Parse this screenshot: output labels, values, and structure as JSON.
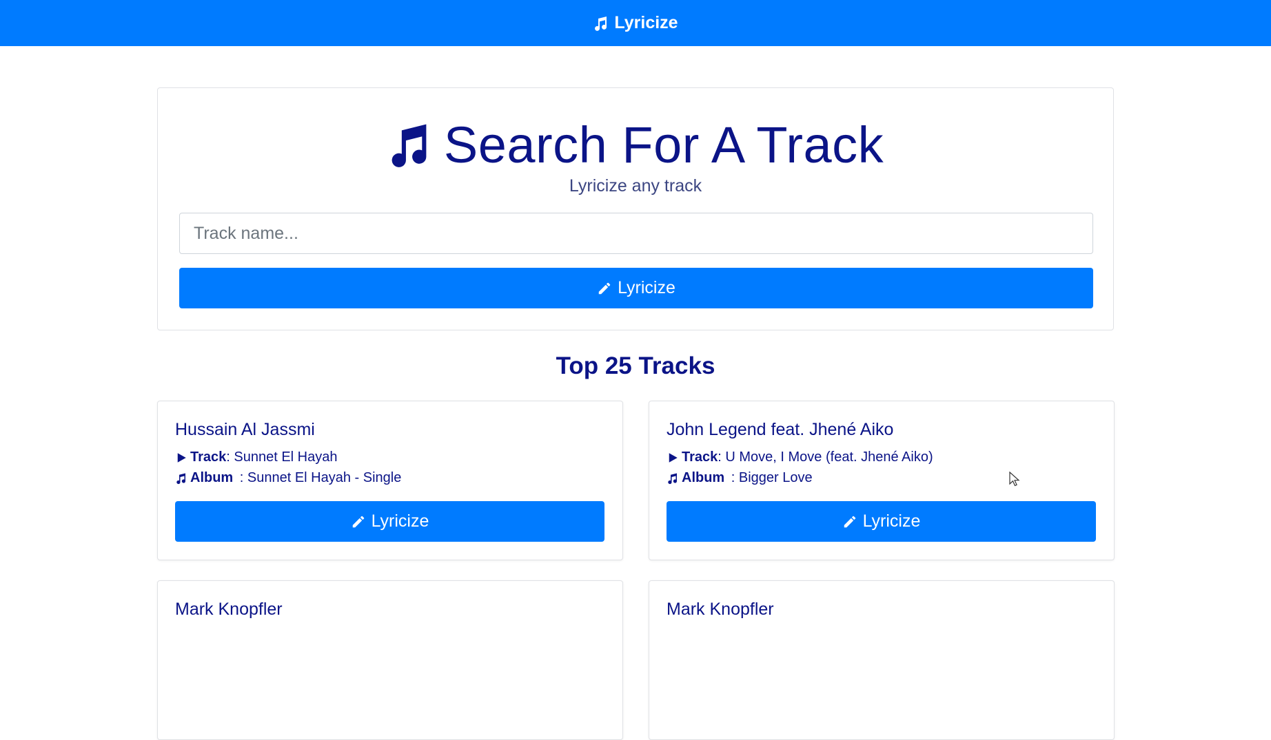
{
  "navbar": {
    "brand_label": "Lyricize",
    "brand_icon": "music-icon"
  },
  "search": {
    "title": "Search For A Track",
    "subtitle": "Lyricize any track",
    "placeholder": "Track name...",
    "button_label": "Lyricize",
    "button_icon": "pencil-icon"
  },
  "section_title": "Top 25 Tracks",
  "tracks": [
    {
      "artist": "Hussain Al Jassmi",
      "track_label": "Track",
      "track_value": ": Sunnet El Hayah",
      "album_label": "Album",
      "album_value": " : Sunnet El Hayah - Single",
      "button_label": "Lyricize"
    },
    {
      "artist": "John Legend feat. Jhené Aiko",
      "track_label": "Track",
      "track_value": ": U Move, I Move (feat. Jhené Aiko)",
      "album_label": "Album",
      "album_value": " : Bigger Love",
      "button_label": "Lyricize"
    },
    {
      "artist": "Mark Knopfler"
    },
    {
      "artist": "Mark Knopfler"
    }
  ],
  "colors": {
    "primary": "#007bff",
    "text": "#0b1487"
  }
}
